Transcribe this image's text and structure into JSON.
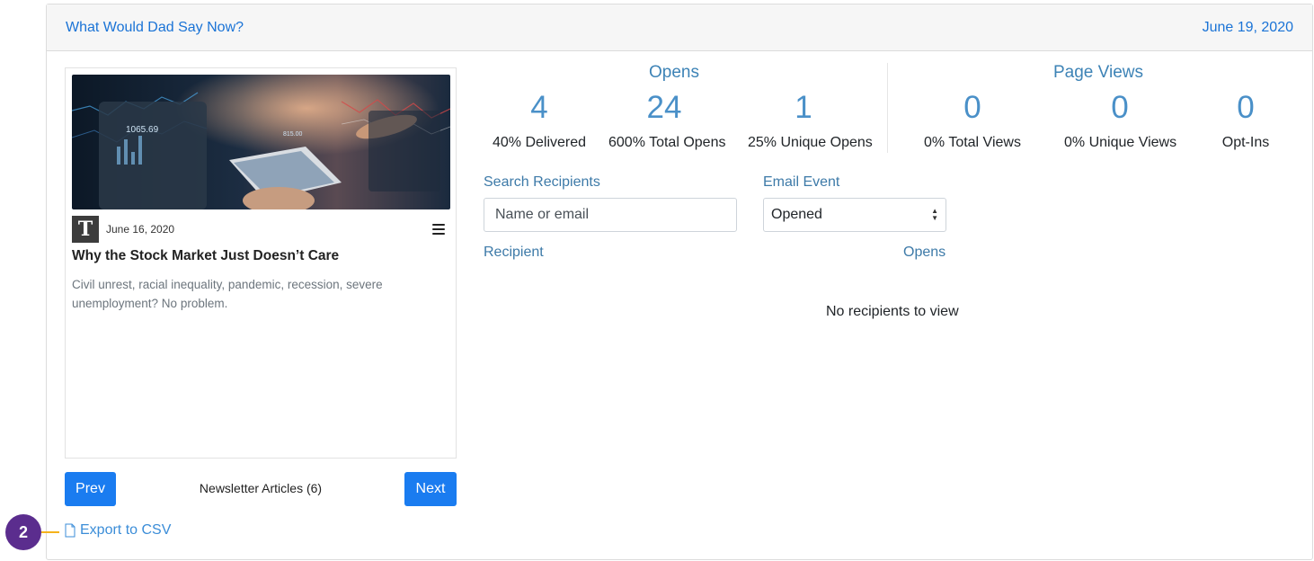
{
  "header": {
    "title": "What Would Dad Say Now?",
    "date": "June 19, 2020"
  },
  "article": {
    "publisher_logo": "T",
    "date": "June 16, 2020",
    "title": "Why the Stock Market Just Doesn’t Care",
    "description": "Civil unrest, racial inequality, pandemic, recession, severe unemployment? No problem.",
    "image_numbers": [
      "1065.69",
      "815.00"
    ]
  },
  "nav": {
    "prev_label": "Prev",
    "next_label": "Next",
    "articles_label": "Newsletter Articles (6)"
  },
  "export_label": "Export to CSV",
  "opens": {
    "title": "Opens",
    "stats": [
      {
        "value": "4",
        "label": "40% Delivered"
      },
      {
        "value": "24",
        "label": "600% Total Opens"
      },
      {
        "value": "1",
        "label": "25% Unique Opens"
      }
    ]
  },
  "page_views": {
    "title": "Page Views",
    "stats": [
      {
        "value": "0",
        "label": "0% Total Views"
      },
      {
        "value": "0",
        "label": "0% Unique Views"
      },
      {
        "value": "0",
        "label": "Opt-Ins"
      }
    ]
  },
  "search": {
    "label": "Search Recipients",
    "placeholder": "Name or email"
  },
  "email_event": {
    "label": "Email Event",
    "selected": "Opened"
  },
  "table": {
    "col_recipient": "Recipient",
    "col_opens": "Opens",
    "empty_text": "No recipients to view"
  },
  "step_badge": "2",
  "colors": {
    "accent": "#1a7cf0",
    "link": "#1a73d6",
    "badge": "#5b2d8e",
    "badge_line": "#f5b21b"
  }
}
